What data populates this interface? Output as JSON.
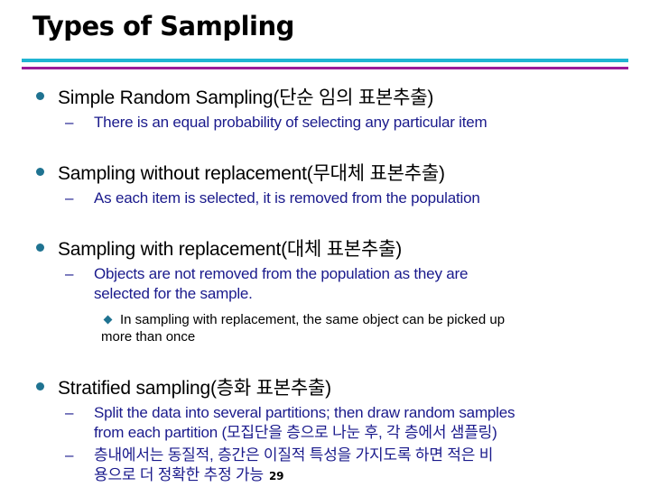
{
  "slide": {
    "title": "Types of Sampling",
    "page_number": "29",
    "colors": {
      "rule_top": "#1fb4d2",
      "rule_bottom": "#9a1a9a",
      "bullet": "#1f7391",
      "subtext": "#1a1a8c"
    },
    "items": [
      {
        "label": "Simple Random Sampling(단순 임의 표본추출)",
        "sub": [
          "There is an equal probability of selecting any particular item"
        ]
      },
      {
        "label": "Sampling without replacement(무대체 표본추출)",
        "sub": [
          "As each item is selected, it is removed from the population"
        ]
      },
      {
        "label": "Sampling with replacement(대체 표본추출)",
        "sub": [
          "Objects are not removed from the population as they are",
          "selected for the sample."
        ],
        "subsub": [
          "In sampling with replacement, the same object can be picked up",
          "more than once"
        ]
      },
      {
        "label": "Stratified sampling(층화 표본추출)",
        "sub": [
          "Split the data into several partitions; then draw random samples",
          "from each partition (모집단을 층으로 나눈 후, 각 층에서 샘플링)"
        ],
        "sub2": [
          "층내에서는 동질적, 층간은 이질적 특성을 가지도록 하면 적은 비",
          "용으로 더 정확한 추정 가능"
        ]
      }
    ]
  }
}
